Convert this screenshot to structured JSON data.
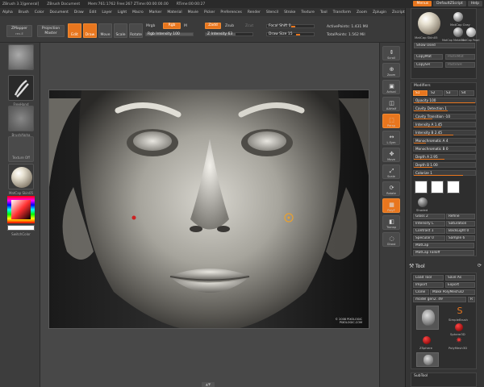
{
  "titlebar": {
    "app": "ZBrush 3.1[general]",
    "document": "ZBrush Document",
    "mem": "Mem:761:1762 Free:267 ZTime:00:00:00.00",
    "time": "RTime:00:00:27",
    "menu_btn": "Menus",
    "script_btn": "DefaultZScript",
    "help_btn": "Help"
  },
  "menubar": [
    "Alpha",
    "Brush",
    "Color",
    "Document",
    "Draw",
    "Edit",
    "Layer",
    "Light",
    "Macro",
    "Marker",
    "Material",
    "Movie",
    "Picker",
    "Preferences",
    "Render",
    "Stencil",
    "Stroke",
    "Texture",
    "Tool",
    "Transform",
    "Zoom",
    "Zplugin",
    "Zscript"
  ],
  "toolbar": {
    "zmapper": "ZMapper",
    "zmapper_sub": "rev-E",
    "projection_master": "Projection Master",
    "edit": "Edit",
    "draw": "Draw",
    "move": "Move",
    "scale": "Scale",
    "rotate": "Rotate",
    "mrgb": "Mrgb",
    "rgb": "Rgb",
    "m": "M",
    "zadd": "Zadd",
    "zsub": "Zsub",
    "zcut": "Zcut",
    "rgb_intensity": "Rgb Intensity 100",
    "z_intensity": "Z Intensity 63",
    "focal_shift": "Focal Shift 0",
    "draw_size": "Draw Size 15",
    "active_points": "ActivePoints: 1.431 Mil",
    "total_points": "TotalPoints: 1.562 Mil"
  },
  "left_shelf": {
    "items": [
      "",
      "FreeHand",
      "BrushAlpha",
      "Texture Off",
      "MatCap Skin05"
    ],
    "switch_color": "SwitchColor",
    "color_note": "Gradient"
  },
  "right_shelf": [
    "Scroll",
    "Zoom",
    "Actual",
    "AAHalf",
    "Persp",
    "L.Sym",
    "Move",
    "Scale",
    "Rotate",
    "PolyF",
    "Transp",
    "Ghost"
  ],
  "canvas": {
    "caption_line1": "© 2008 PIXOLOGIC",
    "caption_line2": "PIXOLOGIC.COM"
  },
  "tray": {
    "materials": [
      "MatCap Skin05",
      "MatCap Gray",
      "MatCap Metal02",
      "MatCap Pearl",
      "MatCap Green"
    ],
    "show_used": "Show Used",
    "copy_mat": "CopyMat",
    "paste_mat": "PasteMat",
    "copy_sh": "CopySH",
    "paste_sh": "PasteSH",
    "modifiers_title": "Modifiers",
    "s1": "S1",
    "s2": "S2",
    "s3": "S3",
    "s4": "S4",
    "mod_sliders": [
      {
        "label": "Opacity 100",
        "fill": 1.0
      },
      {
        "label": "Cavity Detection 1",
        "fill": 0.55
      },
      {
        "label": "Cavity Transition -10",
        "fill": 0.3
      },
      {
        "label": "Intensity A 1.45",
        "fill": 0.45
      },
      {
        "label": "Intensity B 2.45",
        "fill": 0.65
      },
      {
        "label": "Monochromatic A 4",
        "fill": 0.2
      },
      {
        "label": "Monochromatic B 0",
        "fill": 0.0
      },
      {
        "label": "Depth A 2.95",
        "fill": 0.5
      },
      {
        "label": "Depth B 1.00",
        "fill": 0.3
      },
      {
        "label": "Colorize 1",
        "fill": 0.8
      }
    ],
    "shaded": "Shaded",
    "gloss": "Gloss 2",
    "refine": "Refine",
    "intensity_l": "Intensity L",
    "saturation": "Saturation",
    "contrast": "Contrast 1",
    "backlight": "BackLight 0",
    "specular": "Specular 0",
    "sample": "Sample 6",
    "matcap": "MatCap",
    "matcap_falloff": "MatCap Falloff",
    "tool_title": "Tool",
    "load_tool": "Load Tool",
    "save_as": "Save As",
    "import": "Import",
    "export": "Export",
    "clone": "Clone",
    "make_polymesh": "Make PolyMesh3D",
    "model_name": "model gen2. 49",
    "r_btn": "R",
    "tools": [
      "SimpleBrush",
      "Sphere3D",
      "ZSphere",
      "PolyMesh3D"
    ],
    "subtool": "SubTool"
  }
}
